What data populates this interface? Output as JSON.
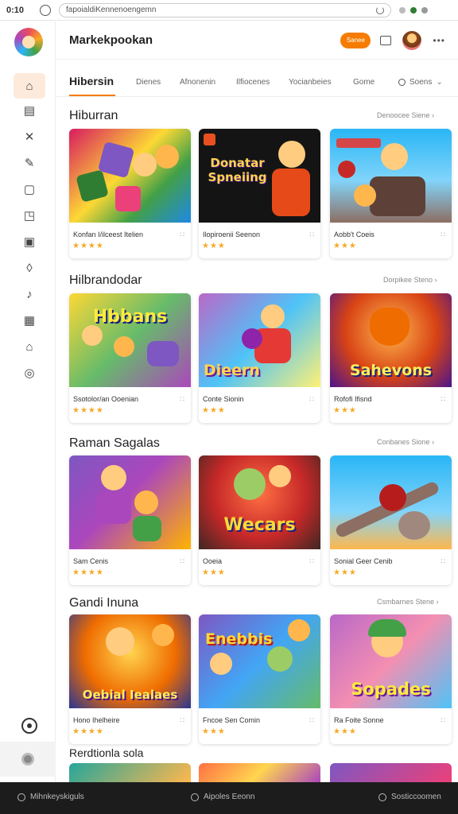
{
  "browser": {
    "clock": "0:10",
    "url": "fapoialdiKennenoengemn"
  },
  "header": {
    "title": "Markekpookan",
    "action_label": "Sanee"
  },
  "tabs": {
    "active": "Hibersin",
    "items": [
      "Dienes",
      "Afnonenin",
      "Ilfiocenes",
      "Yocianbeies",
      "Gome"
    ],
    "search_label": "Soens"
  },
  "sections": [
    {
      "title": "Hiburran",
      "link": "Denoocee Siene",
      "cards": [
        {
          "name": "Konfan I/ilceest Itelien",
          "stars": "★★★★",
          "art": ""
        },
        {
          "name": "Ilopiroenii Seenon",
          "stars": "★★★",
          "art": "Donatar Spneiing"
        },
        {
          "name": "Aobb't Coeis",
          "stars": "★★★",
          "art": ""
        }
      ]
    },
    {
      "title": "Hilbrandodar",
      "link": "Dorpikee Steno",
      "cards": [
        {
          "name": "Ssotolor/an Ooenian",
          "stars": "★★★★",
          "art": "Hbbans"
        },
        {
          "name": "Conte Sionin",
          "stars": "★★★",
          "art": "Dieern"
        },
        {
          "name": "Rofofi Ifisnd",
          "stars": "★★★",
          "art": "Sahevons"
        }
      ]
    },
    {
      "title": "Raman Sagalas",
      "link": "Conbanes Sione",
      "cards": [
        {
          "name": "Sam Cenis",
          "stars": "★★★★",
          "art": ""
        },
        {
          "name": "Ooeia",
          "stars": "★★★",
          "art": "Wecars"
        },
        {
          "name": "Sonial Geer Cenib",
          "stars": "★★★",
          "art": ""
        }
      ]
    },
    {
      "title": "Gandi Inuna",
      "link": "Csmbarnes Stene",
      "cards": [
        {
          "name": "Hono Ihelheire",
          "stars": "★★★★",
          "art": "Oebial Iealaes"
        },
        {
          "name": "Fncoe Sen Comin",
          "stars": "★★★",
          "art": "Enebbis"
        },
        {
          "name": "Ra Foite Sonne",
          "stars": "★★★",
          "art": "Sopades"
        }
      ]
    },
    {
      "title": "Rerdtionla sola"
    }
  ],
  "bottom_bar": {
    "left": "Mihnkeyskiguls",
    "center": "Aipoles Eeonn",
    "right": "Sosticcoomen"
  },
  "colors": {
    "accent": "#f57c00",
    "active_tab_bg": "#fdeadb",
    "stars": "#f9a825",
    "bottom_bar": "#1c1c1c"
  }
}
